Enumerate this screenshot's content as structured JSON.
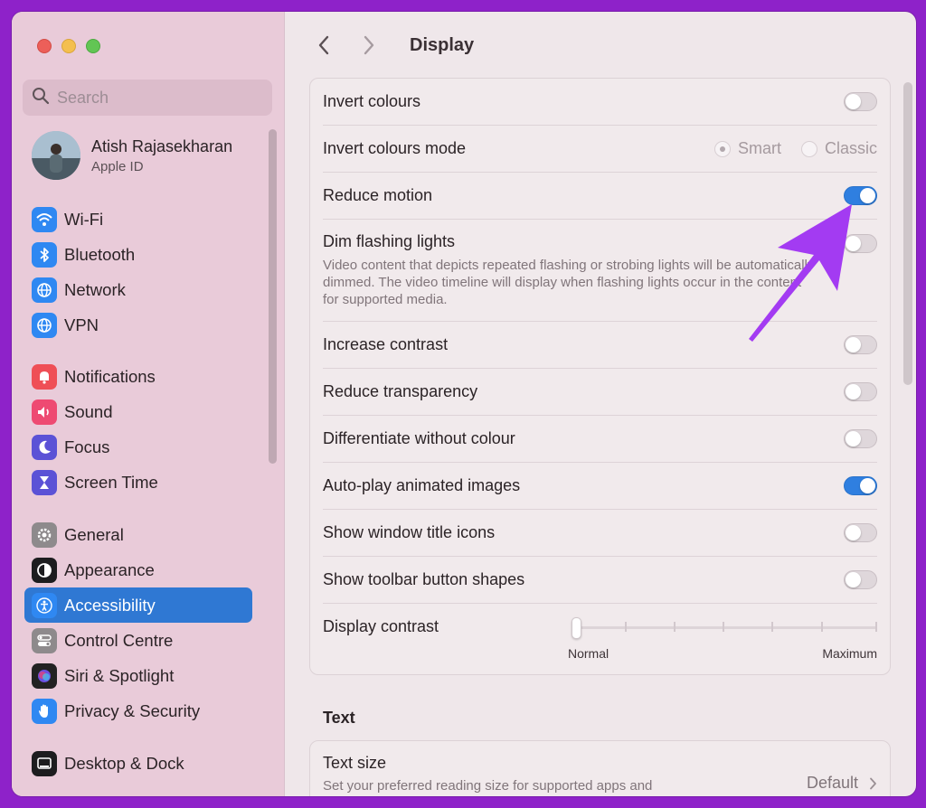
{
  "window": {
    "traffic_lights": [
      "close",
      "minimize",
      "zoom"
    ]
  },
  "search": {
    "placeholder": "Search"
  },
  "user": {
    "name": "Atish Rajasekharan",
    "subtitle": "Apple ID"
  },
  "sidebar": {
    "groups": [
      [
        {
          "label": "Wi-Fi",
          "icon": "wifi-icon",
          "color": "#2f88f2"
        },
        {
          "label": "Bluetooth",
          "icon": "bluetooth-icon",
          "color": "#2f88f2"
        },
        {
          "label": "Network",
          "icon": "globe-icon",
          "color": "#2f88f2"
        },
        {
          "label": "VPN",
          "icon": "globe-icon",
          "color": "#2f88f2"
        }
      ],
      [
        {
          "label": "Notifications",
          "icon": "bell-icon",
          "color": "#ef4f56"
        },
        {
          "label": "Sound",
          "icon": "speaker-icon",
          "color": "#ee4a72"
        },
        {
          "label": "Focus",
          "icon": "moon-icon",
          "color": "#5b52d6"
        },
        {
          "label": "Screen Time",
          "icon": "hourglass-icon",
          "color": "#5b52d6"
        }
      ],
      [
        {
          "label": "General",
          "icon": "gear-icon",
          "color": "#8e8a8c"
        },
        {
          "label": "Appearance",
          "icon": "appearance-icon",
          "color": "#1d1d1f"
        },
        {
          "label": "Accessibility",
          "icon": "accessibility-icon",
          "color": "#2f88f2",
          "active": true
        },
        {
          "label": "Control Centre",
          "icon": "control-centre-icon",
          "color": "#8e8a8c"
        },
        {
          "label": "Siri & Spotlight",
          "icon": "siri-icon",
          "color": "#222222"
        },
        {
          "label": "Privacy & Security",
          "icon": "hand-icon",
          "color": "#2f88f2"
        }
      ],
      [
        {
          "label": "Desktop & Dock",
          "icon": "dock-icon",
          "color": "#1d1d1f"
        }
      ]
    ]
  },
  "toolbar": {
    "title": "Display"
  },
  "display_settings": {
    "invert_colours": {
      "label": "Invert colours",
      "on": false
    },
    "invert_colours_mode": {
      "label": "Invert colours mode",
      "options": [
        "Smart",
        "Classic"
      ],
      "selected": "Smart"
    },
    "reduce_motion": {
      "label": "Reduce motion",
      "on": true
    },
    "dim_flashing": {
      "label": "Dim flashing lights",
      "description": "Video content that depicts repeated flashing or strobing lights will be automatically dimmed. The video timeline will display when flashing lights occur in the content for supported media.",
      "on": false
    },
    "increase_contrast": {
      "label": "Increase contrast",
      "on": false
    },
    "reduce_transparency": {
      "label": "Reduce transparency",
      "on": false
    },
    "differentiate": {
      "label": "Differentiate without colour",
      "on": false
    },
    "autoplay": {
      "label": "Auto-play animated images",
      "on": true
    },
    "window_title_icons": {
      "label": "Show window title icons",
      "on": false
    },
    "toolbar_shapes": {
      "label": "Show toolbar button shapes",
      "on": false
    },
    "display_contrast": {
      "label": "Display contrast",
      "min_label": "Normal",
      "max_label": "Maximum",
      "value": 0
    }
  },
  "text_section": {
    "title": "Text",
    "text_size": {
      "label": "Text size",
      "description": "Set your preferred reading size for supported apps and",
      "value": "Default"
    }
  },
  "colors": {
    "accent": "#2f7fe0",
    "annotation_arrow": "#a33bf2"
  }
}
